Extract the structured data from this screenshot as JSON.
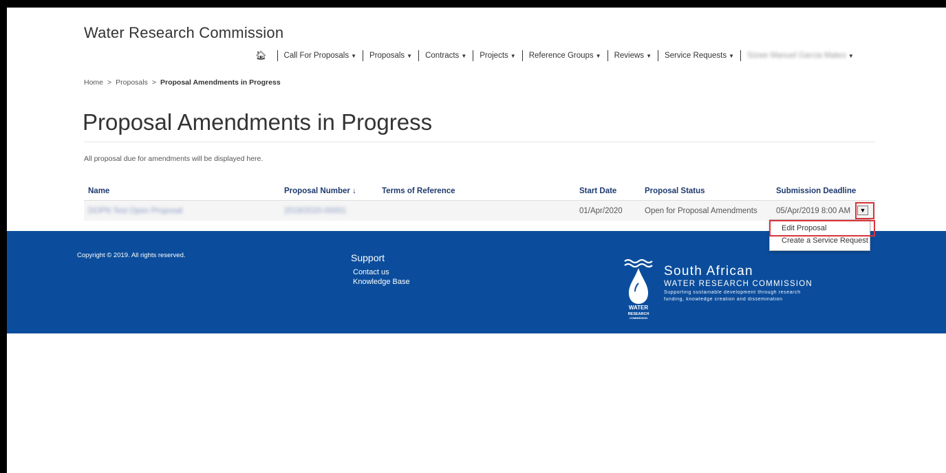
{
  "brand": "Water Research Commission",
  "nav": {
    "items": [
      {
        "label": "Call For Proposals"
      },
      {
        "label": "Proposals"
      },
      {
        "label": "Contracts"
      },
      {
        "label": "Projects"
      },
      {
        "label": "Reference Groups"
      },
      {
        "label": "Reviews"
      },
      {
        "label": "Service Requests"
      }
    ],
    "user_label": "Sizwe Manuel Garcia Mateo"
  },
  "breadcrumb": {
    "home": "Home",
    "proposals": "Proposals",
    "current": "Proposal Amendments in Progress",
    "separator": ">"
  },
  "page": {
    "title": "Proposal Amendments in Progress",
    "description": "All proposal due for amendments will be displayed here."
  },
  "table": {
    "columns": {
      "name": "Name",
      "proposal_number": "Proposal Number",
      "sort_indicator": "↓",
      "terms_of_reference": "Terms of Reference",
      "start_date": "Start Date",
      "proposal_status": "Proposal Status",
      "submission_deadline": "Submission Deadline"
    },
    "rows": [
      {
        "name": "DOPN Test Open Proposal",
        "proposal_number": "2019/2020-00001",
        "terms_of_reference": "",
        "start_date": "01/Apr/2020",
        "proposal_status": "Open for Proposal Amendments",
        "submission_deadline": "05/Apr/2019 8:00 AM"
      }
    ]
  },
  "row_menu": {
    "items": [
      "Edit Proposal",
      "Create a Service Request"
    ]
  },
  "footer": {
    "copyright": "Copyright © 2019. All rights reserved.",
    "support_title": "Support",
    "links": [
      "Contact us",
      "Knowledge Base"
    ],
    "logo": {
      "line1": "South African",
      "line2": "WATER RESEARCH COMMISSION",
      "line3": "Supporting sustainable development through research",
      "line4": "funding, knowledge creation and dissemination",
      "mark_words": [
        "WATER",
        "RESEARCH",
        "COMMISSION"
      ]
    }
  },
  "colors": {
    "footer_bg": "#0b4d9c",
    "header_link": "#1e3a6e",
    "highlight": "#d9343a"
  }
}
